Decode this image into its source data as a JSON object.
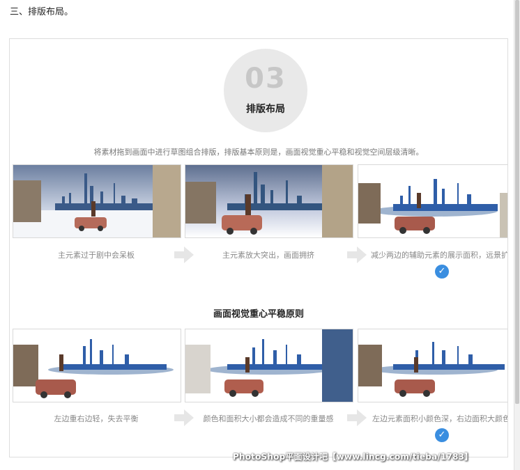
{
  "heading": "三、排版布局。",
  "badge": {
    "number": "03",
    "title": "排版布局"
  },
  "intro": "将素材拖到画面中进行草图组合排版，排版基本原则是，画面视觉重心平稳和视觉空间层级清晰。",
  "row1": {
    "captions": [
      "主元素过于剧中会呆板",
      "主元素放大突出，画面拥挤",
      "减少两边的辅助元素的展示面积，远景扩"
    ]
  },
  "section_title": "画面视觉重心平稳原则",
  "row2": {
    "captions": [
      "左边重右边轻，失去平衡",
      "颜色和面积大小都会造成不同的重量感",
      "左边元素面积小颜色深，右边面积大颜色"
    ]
  },
  "watermark": "PhotoShop平面设计吧【www.lincg.com/tieba/1783】",
  "icons": {
    "check": "check-circle-icon",
    "arrow": "arrow-right-icon"
  },
  "colors": {
    "check": "#3a8ee0",
    "circle": "#e9e9e9",
    "border": "#d9d9d9"
  }
}
